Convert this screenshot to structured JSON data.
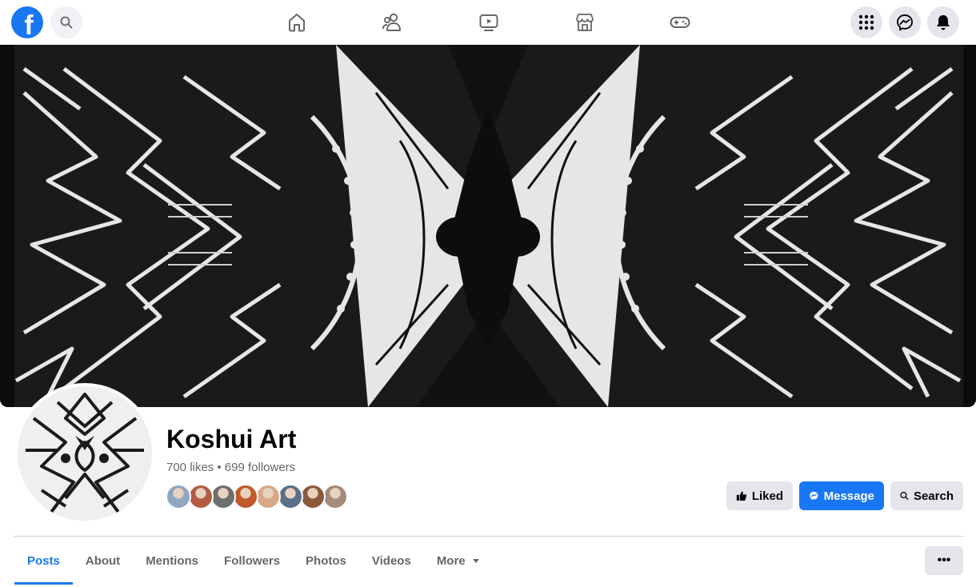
{
  "topbar": {
    "logo_letter": "f",
    "nav": [
      "home-icon",
      "friends-icon",
      "watch-icon",
      "marketplace-icon",
      "gaming-icon"
    ],
    "right": [
      "menu-grid-icon",
      "messenger-icon",
      "notifications-icon"
    ]
  },
  "page": {
    "name": "Koshui Art",
    "stats": "700 likes • 699 followers",
    "friend_avatar_colors": [
      "#8fa7c2",
      "#b35c43",
      "#6e6e6e",
      "#c15a2a",
      "#d9a88a",
      "#5b6f86",
      "#8b5a3c",
      "#a48c7a"
    ]
  },
  "actions": {
    "liked_label": "Liked",
    "message_label": "Message",
    "search_label": "Search"
  },
  "tabs": {
    "items": [
      "Posts",
      "About",
      "Mentions",
      "Followers",
      "Photos",
      "Videos",
      "More"
    ],
    "active": "Posts",
    "more_menu_label": "•••"
  },
  "colors": {
    "brand": "#1877f2",
    "button_gray": "#e4e6eb",
    "text_secondary": "#65676b"
  }
}
